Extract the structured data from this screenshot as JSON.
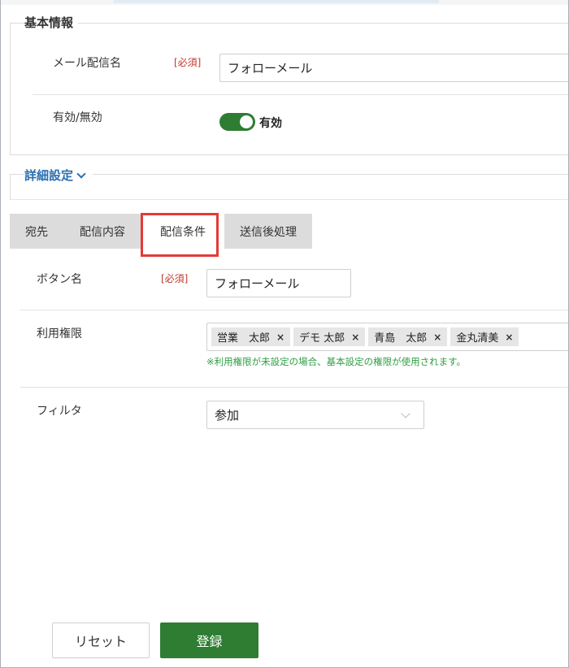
{
  "basic_info": {
    "title": "基本情報",
    "mail_name_label": "メール配信名",
    "required_label": "[必須]",
    "mail_name_value": "フォローメール",
    "enabled_label": "有効/無効",
    "toggle_state_label": "有効"
  },
  "advanced": {
    "title": "詳細設定"
  },
  "tabs": [
    {
      "label": "宛先"
    },
    {
      "label": "配信内容"
    },
    {
      "label": "配信条件"
    },
    {
      "label": "送信後処理"
    }
  ],
  "form": {
    "button_name_label": "ボタン名",
    "required_label": "[必須]",
    "button_name_value": "フォローメール",
    "permission_label": "利用権限",
    "permission_tags": [
      {
        "label": "営業　太郎",
        "remove": "×"
      },
      {
        "label": "デモ 太郎",
        "remove": "×"
      },
      {
        "label": "青島　太郎",
        "remove": "×"
      },
      {
        "label": "金丸清美",
        "remove": "×"
      }
    ],
    "permission_note": "※利用権限が未設定の場合、基本設定の権限が使用されます。",
    "filter_label": "フィルタ",
    "filter_value": "参加"
  },
  "buttons": {
    "reset": "リセット",
    "submit": "登録"
  },
  "colors": {
    "accent_green": "#2e7d32",
    "link_blue": "#2a6fb0",
    "required_red": "#c0392b",
    "highlight_red": "#e53935"
  }
}
